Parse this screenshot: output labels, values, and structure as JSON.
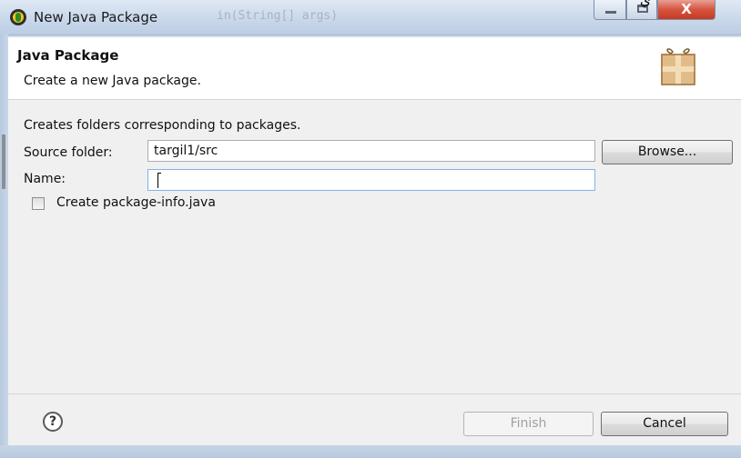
{
  "window": {
    "title": "New Java Package",
    "background_code": "in(String[] args)",
    "overlay_glyph": "ي",
    "close_label": "X"
  },
  "header": {
    "title": "Java Package",
    "description": "Create a new Java package."
  },
  "form": {
    "intro": "Creates folders corresponding to packages.",
    "source_folder_label": "Source folder:",
    "source_folder_value": "targil1/src",
    "browse_label": "Browse...",
    "name_label": "Name:",
    "name_value": "",
    "checkbox_label": "Create package-info.java",
    "checkbox_checked": false
  },
  "footer": {
    "help_symbol": "?",
    "finish_label": "Finish",
    "finish_enabled": false,
    "cancel_label": "Cancel"
  },
  "icons": {
    "app": "eclipse-icon",
    "header": "package-icon",
    "help": "help-icon"
  },
  "colors": {
    "title_bar": "#c9d8ea",
    "close_button": "#d6543f",
    "dialog_bg": "#f0f0f0",
    "focus_border": "#7eb4ea"
  }
}
